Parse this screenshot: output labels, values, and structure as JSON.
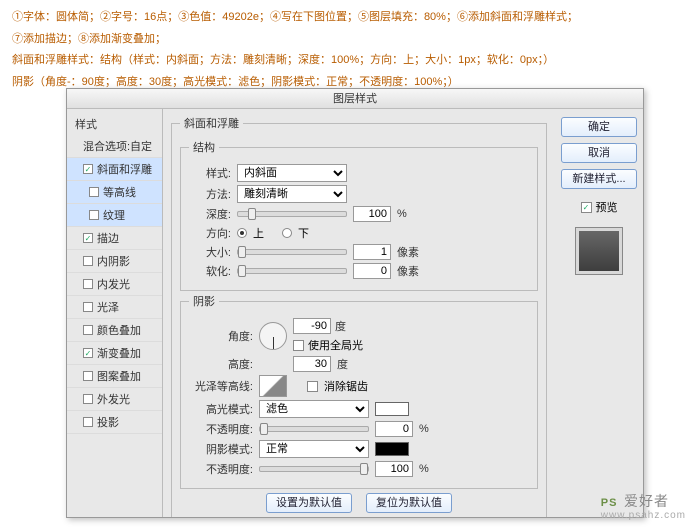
{
  "notes": {
    "l1": "①字体：圆体简；②字号：16点；③色值：49202e；④写在下图位置；⑤图层填充：80%；⑥添加斜面和浮雕样式；",
    "l2": "⑦添加描边；⑧添加渐变叠加；",
    "l3": "斜面和浮雕样式：结构（样式：内斜面；方法：雕刻清晰；深度：100%；方向：上；大小：1px；软化：0px；）",
    "l4": "阴影（角度-：90度；高度：30度；高光模式：滤色；阴影模式：正常；不透明度：100%；）"
  },
  "dialog": {
    "title": "图层样式"
  },
  "sidebar": {
    "header": "样式",
    "blend": "混合选项:自定",
    "items": [
      {
        "label": "斜面和浮雕",
        "checked": true,
        "sel": true
      },
      {
        "label": "等高线",
        "checked": false,
        "indent": true
      },
      {
        "label": "纹理",
        "checked": false,
        "indent": true
      },
      {
        "label": "描边",
        "checked": true
      },
      {
        "label": "内阴影",
        "checked": false
      },
      {
        "label": "内发光",
        "checked": false
      },
      {
        "label": "光泽",
        "checked": false
      },
      {
        "label": "颜色叠加",
        "checked": false
      },
      {
        "label": "渐变叠加",
        "checked": true
      },
      {
        "label": "图案叠加",
        "checked": false
      },
      {
        "label": "外发光",
        "checked": false
      },
      {
        "label": "投影",
        "checked": false
      }
    ]
  },
  "panel": {
    "bevel_legend": "斜面和浮雕",
    "structure_legend": "结构",
    "style_label": "样式:",
    "style_value": "内斜面",
    "method_label": "方法:",
    "method_value": "雕刻清晰",
    "depth_label": "深度:",
    "depth_value": "100",
    "depth_unit": "%",
    "dir_label": "方向:",
    "dir_up": "上",
    "dir_down": "下",
    "size_label": "大小:",
    "size_value": "1",
    "size_unit": "像素",
    "soften_label": "软化:",
    "soften_value": "0",
    "soften_unit": "像素",
    "shading_legend": "阴影",
    "angle_label": "角度:",
    "angle_value": "-90",
    "angle_unit": "度",
    "global_label": "使用全局光",
    "alt_label": "高度:",
    "alt_value": "30",
    "alt_unit": "度",
    "gloss_label": "光泽等高线:",
    "antialias_label": "消除锯齿",
    "hmode_label": "高光模式:",
    "hmode_value": "滤色",
    "hopacity_label": "不透明度:",
    "hopacity_value": "0",
    "hopacity_unit": "%",
    "smode_label": "阴影模式:",
    "smode_value": "正常",
    "sopacity_label": "不透明度:",
    "sopacity_value": "100",
    "sopacity_unit": "%",
    "set_default": "设置为默认值",
    "reset_default": "复位为默认值"
  },
  "buttons": {
    "ok": "确定",
    "cancel": "取消",
    "newstyle": "新建样式...",
    "preview": "预览"
  },
  "colors": {
    "highlight": "#ffffff",
    "shadow": "#000000"
  },
  "watermark": {
    "logo": "PS",
    "cn": "爱好者",
    "url": "www.psahz.com"
  }
}
